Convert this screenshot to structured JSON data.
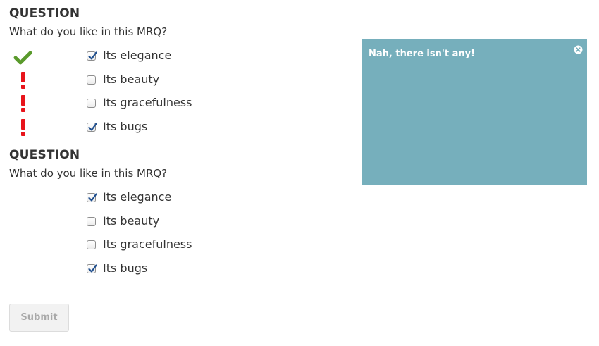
{
  "questions": [
    {
      "heading": "QUESTION",
      "prompt": "What do you like in this MRQ?",
      "choices": [
        {
          "label": "Its elegance",
          "checked": true,
          "feedback": "correct"
        },
        {
          "label": "Its beauty",
          "checked": false,
          "feedback": "incorrect"
        },
        {
          "label": "Its gracefulness",
          "checked": false,
          "feedback": "incorrect"
        },
        {
          "label": "Its bugs",
          "checked": true,
          "feedback": "incorrect"
        }
      ]
    },
    {
      "heading": "QUESTION",
      "prompt": "What do you like in this MRQ?",
      "choices": [
        {
          "label": "Its elegance",
          "checked": true,
          "feedback": "none"
        },
        {
          "label": "Its beauty",
          "checked": false,
          "feedback": "none"
        },
        {
          "label": "Its gracefulness",
          "checked": false,
          "feedback": "none"
        },
        {
          "label": "Its bugs",
          "checked": true,
          "feedback": "none"
        }
      ]
    }
  ],
  "popup": {
    "message": "Nah, there isn't any!",
    "background": "#76afbc",
    "close_icon": "close-circle-icon"
  },
  "submit": {
    "label": "Submit",
    "disabled": true
  },
  "colors": {
    "correct": "#5a9a2c",
    "incorrect": "#e8141b",
    "checkmark": "#1f4f8f"
  },
  "icons": {
    "correct": "checkmark-icon",
    "incorrect": "exclamation-icon"
  }
}
